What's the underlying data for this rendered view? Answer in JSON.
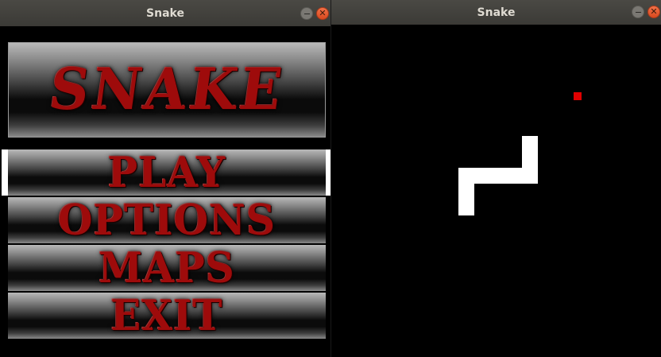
{
  "menu_window": {
    "title": "Snake",
    "logo_text": "SNAKE",
    "items": [
      {
        "label": "PLAY",
        "selected": true
      },
      {
        "label": "OPTIONS",
        "selected": false
      },
      {
        "label": "MAPS",
        "selected": false
      },
      {
        "label": "EXIT",
        "selected": false
      }
    ]
  },
  "game_window": {
    "title": "Snake",
    "colors": {
      "background": "#000000",
      "snake": "#ffffff",
      "food": "#e00000"
    }
  }
}
